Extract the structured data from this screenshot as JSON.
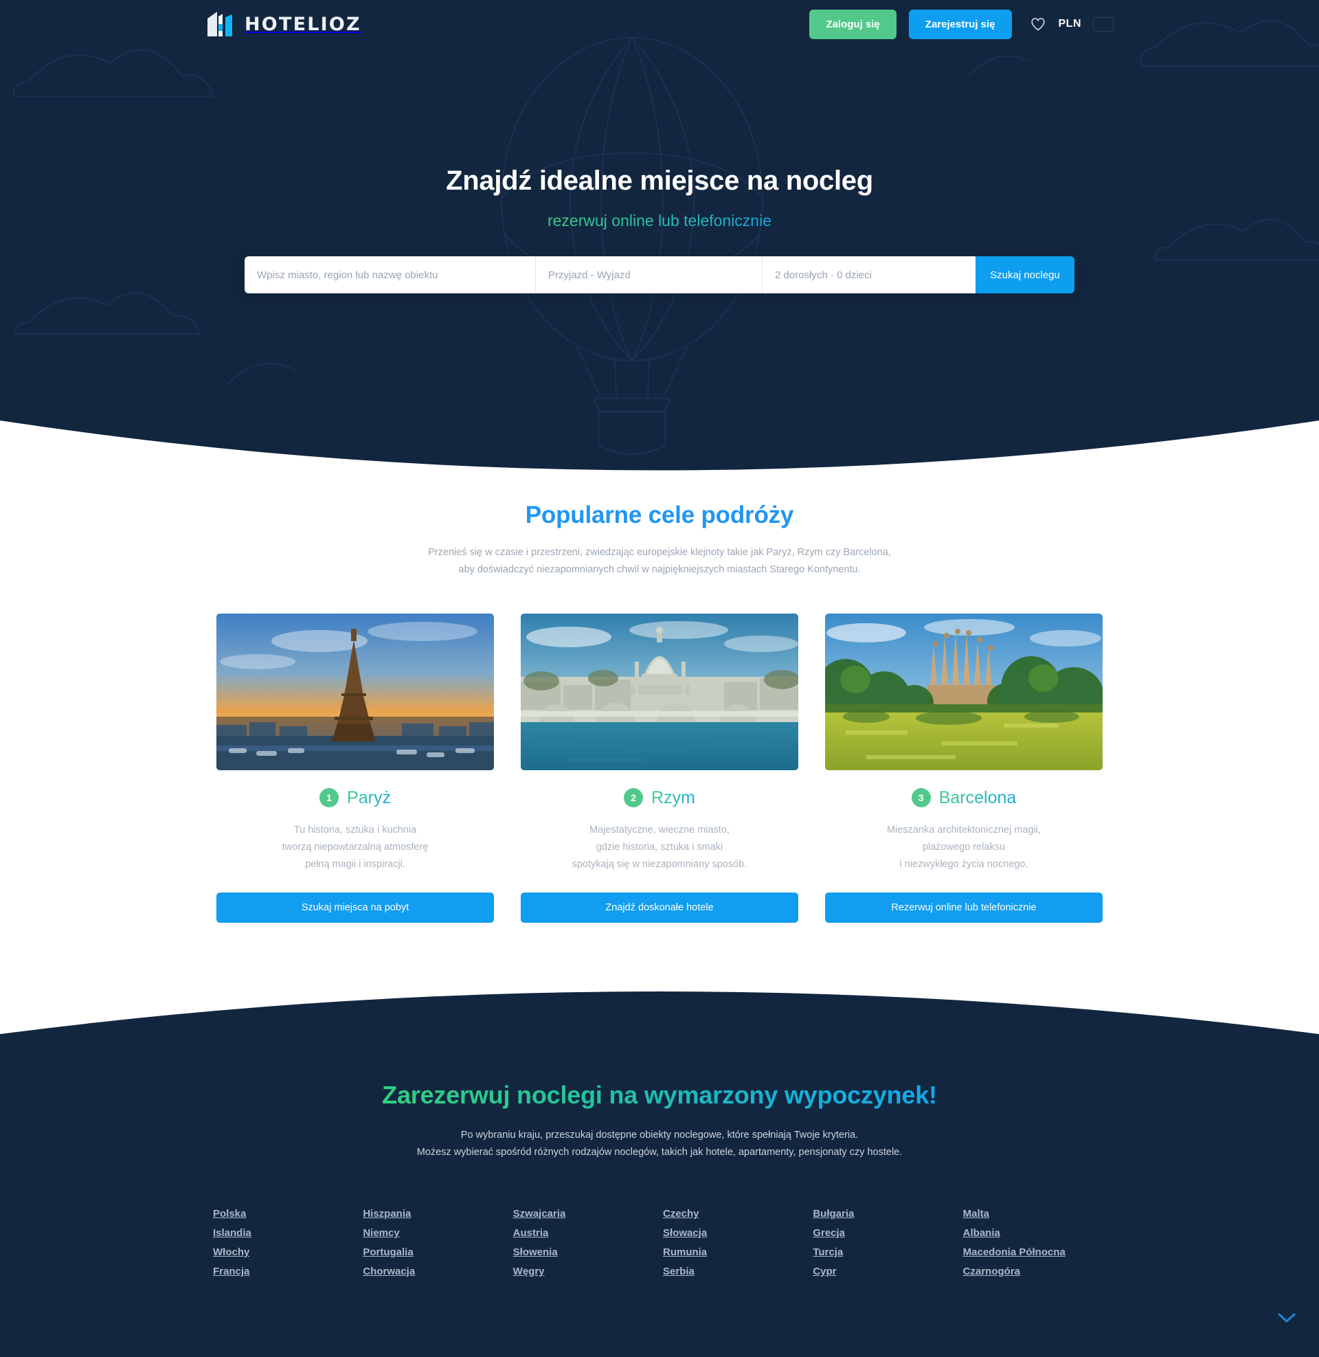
{
  "brand": {
    "name": "HOTELIOZ",
    "logo_icon": "building-logo-icon",
    "accent_blue": "#0d9ef0",
    "accent_green": "#52c98a",
    "dark_navy": "#13263f"
  },
  "topbar": {
    "login_label": "Zaloguj się",
    "register_label": "Zarejestruj się",
    "favorites_icon": "heart-icon",
    "currency": "PLN",
    "flag": "poland-flag-icon"
  },
  "hero": {
    "title": "Znajdź idealne miejsce na nocleg",
    "subtitle": "rezerwuj online lub telefonicznie",
    "search": {
      "destination_placeholder": "Wpisz miasto, region lub nazwę obiektu",
      "destination_value": "",
      "dates_value": "Przyjazd - Wyjazd",
      "guests_value": "2 dorosłych · 0 dzieci",
      "submit_label": "Szukaj noclegu"
    }
  },
  "popular": {
    "title": "Popularne cele podróży",
    "description_line1": "Przenieś się w czasie i przestrzeni, zwiedzając europejskie klejnoty takie jak Paryż, Rzym czy Barcelona,",
    "description_line2": "aby doświadczyć niezapomnianych chwil w najpiękniejszych miastach Starego Kontynentu.",
    "cards": [
      {
        "rank": "1",
        "name": "Paryż",
        "image": "eiffel-tower-sunset-photo",
        "desc_line1": "Tu historia, sztuka i kuchnia",
        "desc_line2": "tworzą niepowtarzalną atmosferę",
        "desc_line3": "pełną magii i inspiracji.",
        "button_label": "Szukaj miejsca na pobyt"
      },
      {
        "rank": "2",
        "name": "Rzym",
        "image": "vatican-tiber-bridge-photo",
        "desc_line1": "Majestatyczne, wieczne miasto,",
        "desc_line2": "gdzie historia, sztuka i smaki",
        "desc_line3": "spotykają się w niezapomniany sposób.",
        "button_label": "Znajdź doskonałe hotele"
      },
      {
        "rank": "3",
        "name": "Barcelona",
        "image": "sagrada-familia-park-photo",
        "desc_line1": "Mieszanka architektonicznej magii,",
        "desc_line2": "plażowego relaksu",
        "desc_line3": "i niezwykłego życia nocnego.",
        "button_label": "Rezerwuj online lub telefonicznie"
      }
    ]
  },
  "booking": {
    "title": "Zarezerwuj noclegi na wymarzony wypoczynek!",
    "description_line1": "Po wybraniu kraju, przeszukaj dostępne obiekty noclegowe, które spełniają Twoje kryteria.",
    "description_line2": "Możesz wybierać spośród różnych rodzajów noclegów, takich jak hotele, apartamenty, pensjonaty czy hostele.",
    "countries": [
      "Polska",
      "Islandia",
      "Włochy",
      "Francja",
      "Hiszpania",
      "Niemcy",
      "Portugalia",
      "Chorwacja",
      "Szwajcaria",
      "Austria",
      "Słowenia",
      "Węgry",
      "Czechy",
      "Słowacja",
      "Rumunia",
      "Serbia",
      "Bułgaria",
      "Grecja",
      "Turcja",
      "Cypr",
      "Malta",
      "Albania",
      "Macedonia Północna",
      "Czarnogóra"
    ],
    "scroll_icon": "chevron-down-icon"
  }
}
